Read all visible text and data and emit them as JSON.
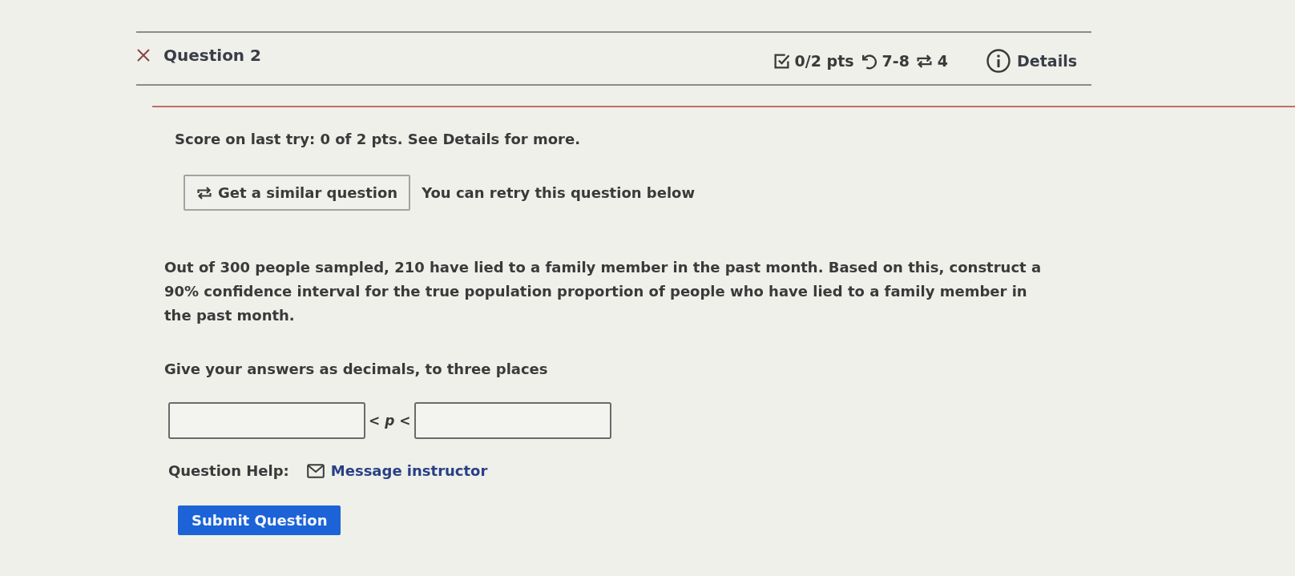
{
  "question_header": {
    "correct": false,
    "title": "Question 2",
    "score": "0/2 pts",
    "attempts": "7-8",
    "versions": "4",
    "details_link": "Details"
  },
  "score_message": "Score on last try: 0 of 2 pts. See Details for more.",
  "retry": {
    "button": "Get a similar question",
    "note": "You can retry this question below"
  },
  "question_text": "Out of 300 people sampled, 210 have lied to a family member in the past month. Based on this, construct a 90% confidence interval for the true population proportion of people who have lied to a family member in the past month.",
  "instruction": "Give your answers as decimals, to three places",
  "answer_row": [
    {
      "kind": "field"
    },
    {
      "kind": "text",
      "text": "< *p* <"
    },
    {
      "kind": "field"
    }
  ],
  "help": {
    "label": "Question Help:",
    "link": "Message instructor"
  },
  "submit_button": "Submit Question"
}
